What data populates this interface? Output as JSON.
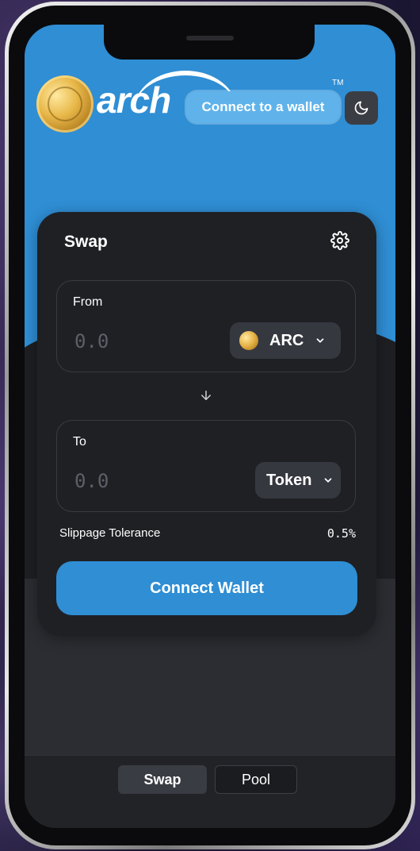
{
  "header": {
    "logo_text": "arch",
    "tm": "TM",
    "connect_label": "Connect to a wallet"
  },
  "swap_card": {
    "title": "Swap",
    "from": {
      "label": "From",
      "amount_placeholder": "0.0",
      "token": "ARC"
    },
    "to": {
      "label": "To",
      "amount_placeholder": "0.0",
      "token": "Token"
    },
    "slippage_label": "Slippage Tolerance",
    "slippage_value": "0.5%",
    "connect_wallet_label": "Connect Wallet"
  },
  "bottom_nav": {
    "swap_label": "Swap",
    "pool_label": "Pool"
  },
  "colors": {
    "accent_blue": "#2f8ed4",
    "card_bg": "#1f2024",
    "token_btn_bg": "#363840"
  },
  "icons": [
    "moon-icon",
    "gear-icon",
    "chevron-down-icon",
    "arrow-down-icon",
    "arc-coin-icon"
  ]
}
